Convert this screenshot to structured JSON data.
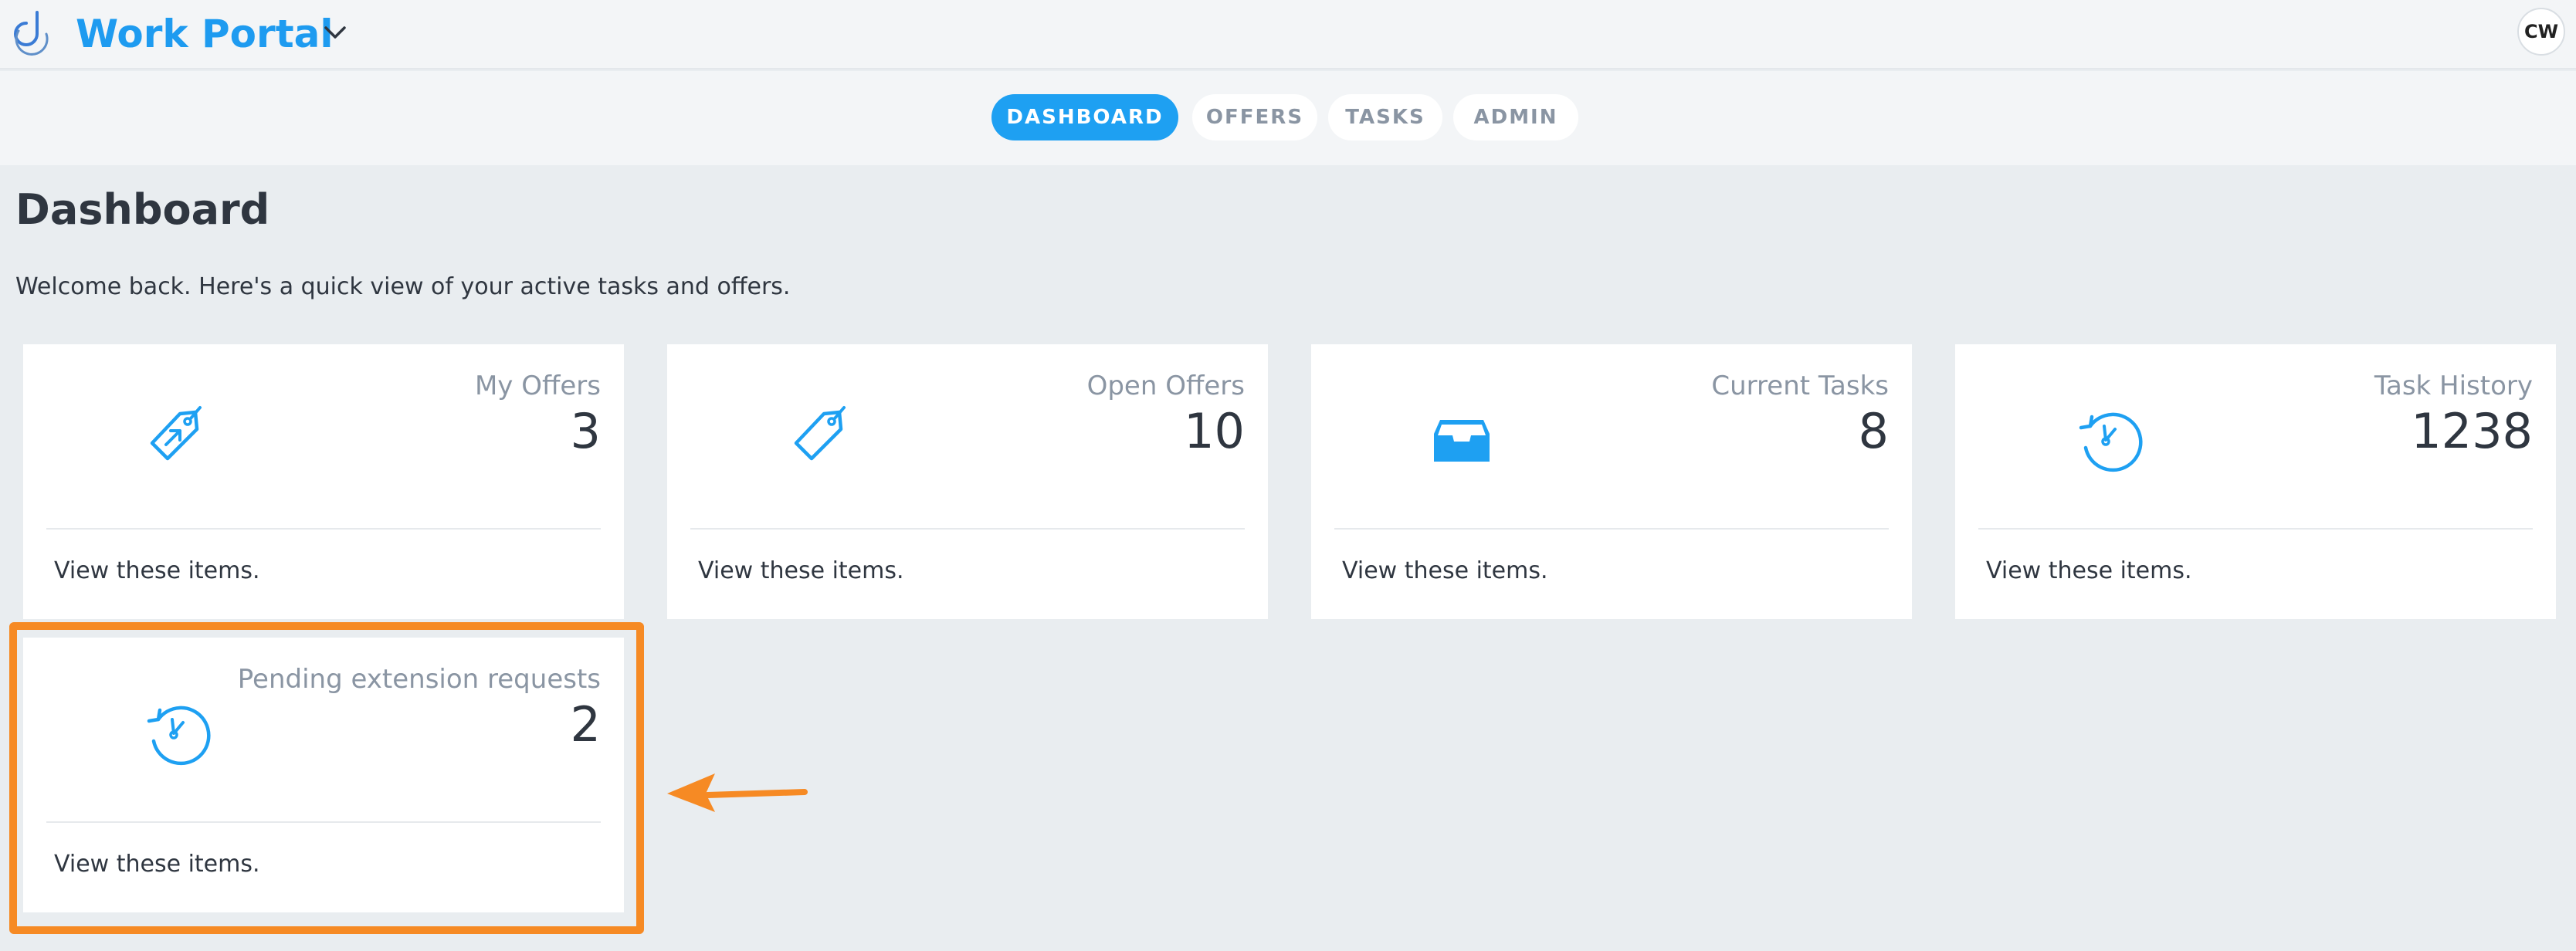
{
  "header": {
    "app_title": "Work Portal",
    "user_initials": "CW"
  },
  "nav": {
    "tabs": [
      {
        "label": "DASHBOARD",
        "active": true
      },
      {
        "label": "OFFERS",
        "active": false
      },
      {
        "label": "TASKS",
        "active": false
      },
      {
        "label": "ADMIN",
        "active": false
      }
    ]
  },
  "main": {
    "title": "Dashboard",
    "welcome": "Welcome back. Here's a quick view of your active tasks and offers.",
    "cards": [
      {
        "label": "My Offers",
        "count": "3",
        "link": "View these items.",
        "icon": "tag-arrow-icon"
      },
      {
        "label": "Open Offers",
        "count": "10",
        "link": "View these items.",
        "icon": "tag-icon"
      },
      {
        "label": "Current Tasks",
        "count": "8",
        "link": "View these items.",
        "icon": "inbox-tray-icon"
      },
      {
        "label": "Task History",
        "count": "1238",
        "link": "View these items.",
        "icon": "history-clock-icon"
      },
      {
        "label": "Pending extension requests",
        "count": "2",
        "link": "View these items.",
        "icon": "history-clock-icon"
      }
    ]
  },
  "colors": {
    "accent": "#1ea0f2",
    "highlight": "#f68a24",
    "background": "#e9edf0"
  }
}
